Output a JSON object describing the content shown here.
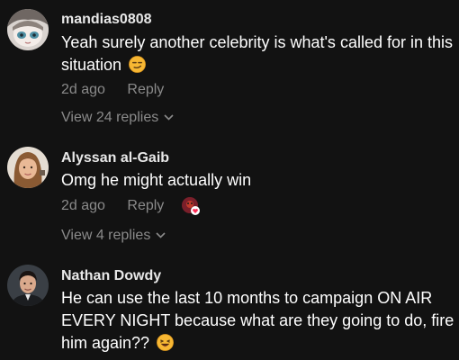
{
  "comments": [
    {
      "username": "mandias0808",
      "text": "Yeah surely another celebrity is what's called for in this situation",
      "emoji": "smirk-emoji",
      "age": "2d ago",
      "reply_label": "Reply",
      "view_replies": "View 24 replies"
    },
    {
      "username": "Alyssan al-Gaib",
      "text": "Omg he might actually win",
      "age": "2d ago",
      "reply_label": "Reply",
      "reaction": "creator-liked-reaction-icon",
      "view_replies": "View 4 replies"
    },
    {
      "username": "Nathan Dowdy",
      "text": "He can use the last 10 months to campaign ON AIR EVERY NIGHT because what are they going to do, fire him again??",
      "emoji": "laughing-emoji"
    }
  ],
  "colors": {
    "background": "#121212",
    "primary_text": "#ffffff",
    "secondary_text": "#8a8a8a",
    "heart": "#fe2c55"
  }
}
